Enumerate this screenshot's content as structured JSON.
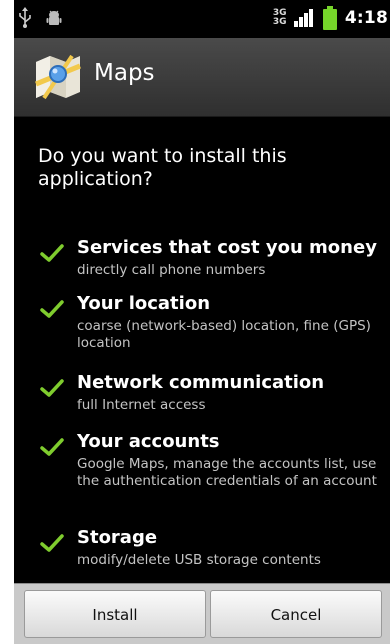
{
  "status_bar": {
    "time": "4:18",
    "network_top": "3G",
    "network_bottom": "3G",
    "icons": [
      "usb-icon",
      "android-debug-icon",
      "network-3g-icon",
      "signal-icon",
      "battery-icon"
    ]
  },
  "title_bar": {
    "title": "Maps",
    "icon": "maps-app-icon"
  },
  "content": {
    "question": "Do you want to install this application?",
    "permissions": [
      {
        "title": "Services that cost you money",
        "desc": "directly call phone numbers"
      },
      {
        "title": "Your location",
        "desc": "coarse (network-based) location, fine (GPS) location"
      },
      {
        "title": "Network communication",
        "desc": "full Internet access"
      },
      {
        "title": "Your accounts",
        "desc": "Google Maps, manage the accounts list, use the authentication credentials of an account"
      },
      {
        "title": "Storage",
        "desc": "modify/delete USB storage contents"
      }
    ]
  },
  "buttons": {
    "install": "Install",
    "cancel": "Cancel"
  },
  "colors": {
    "check": "#7fcc2e",
    "battery": "#76d42a",
    "background": "#000000",
    "button_bar": "#c9c9c9"
  }
}
